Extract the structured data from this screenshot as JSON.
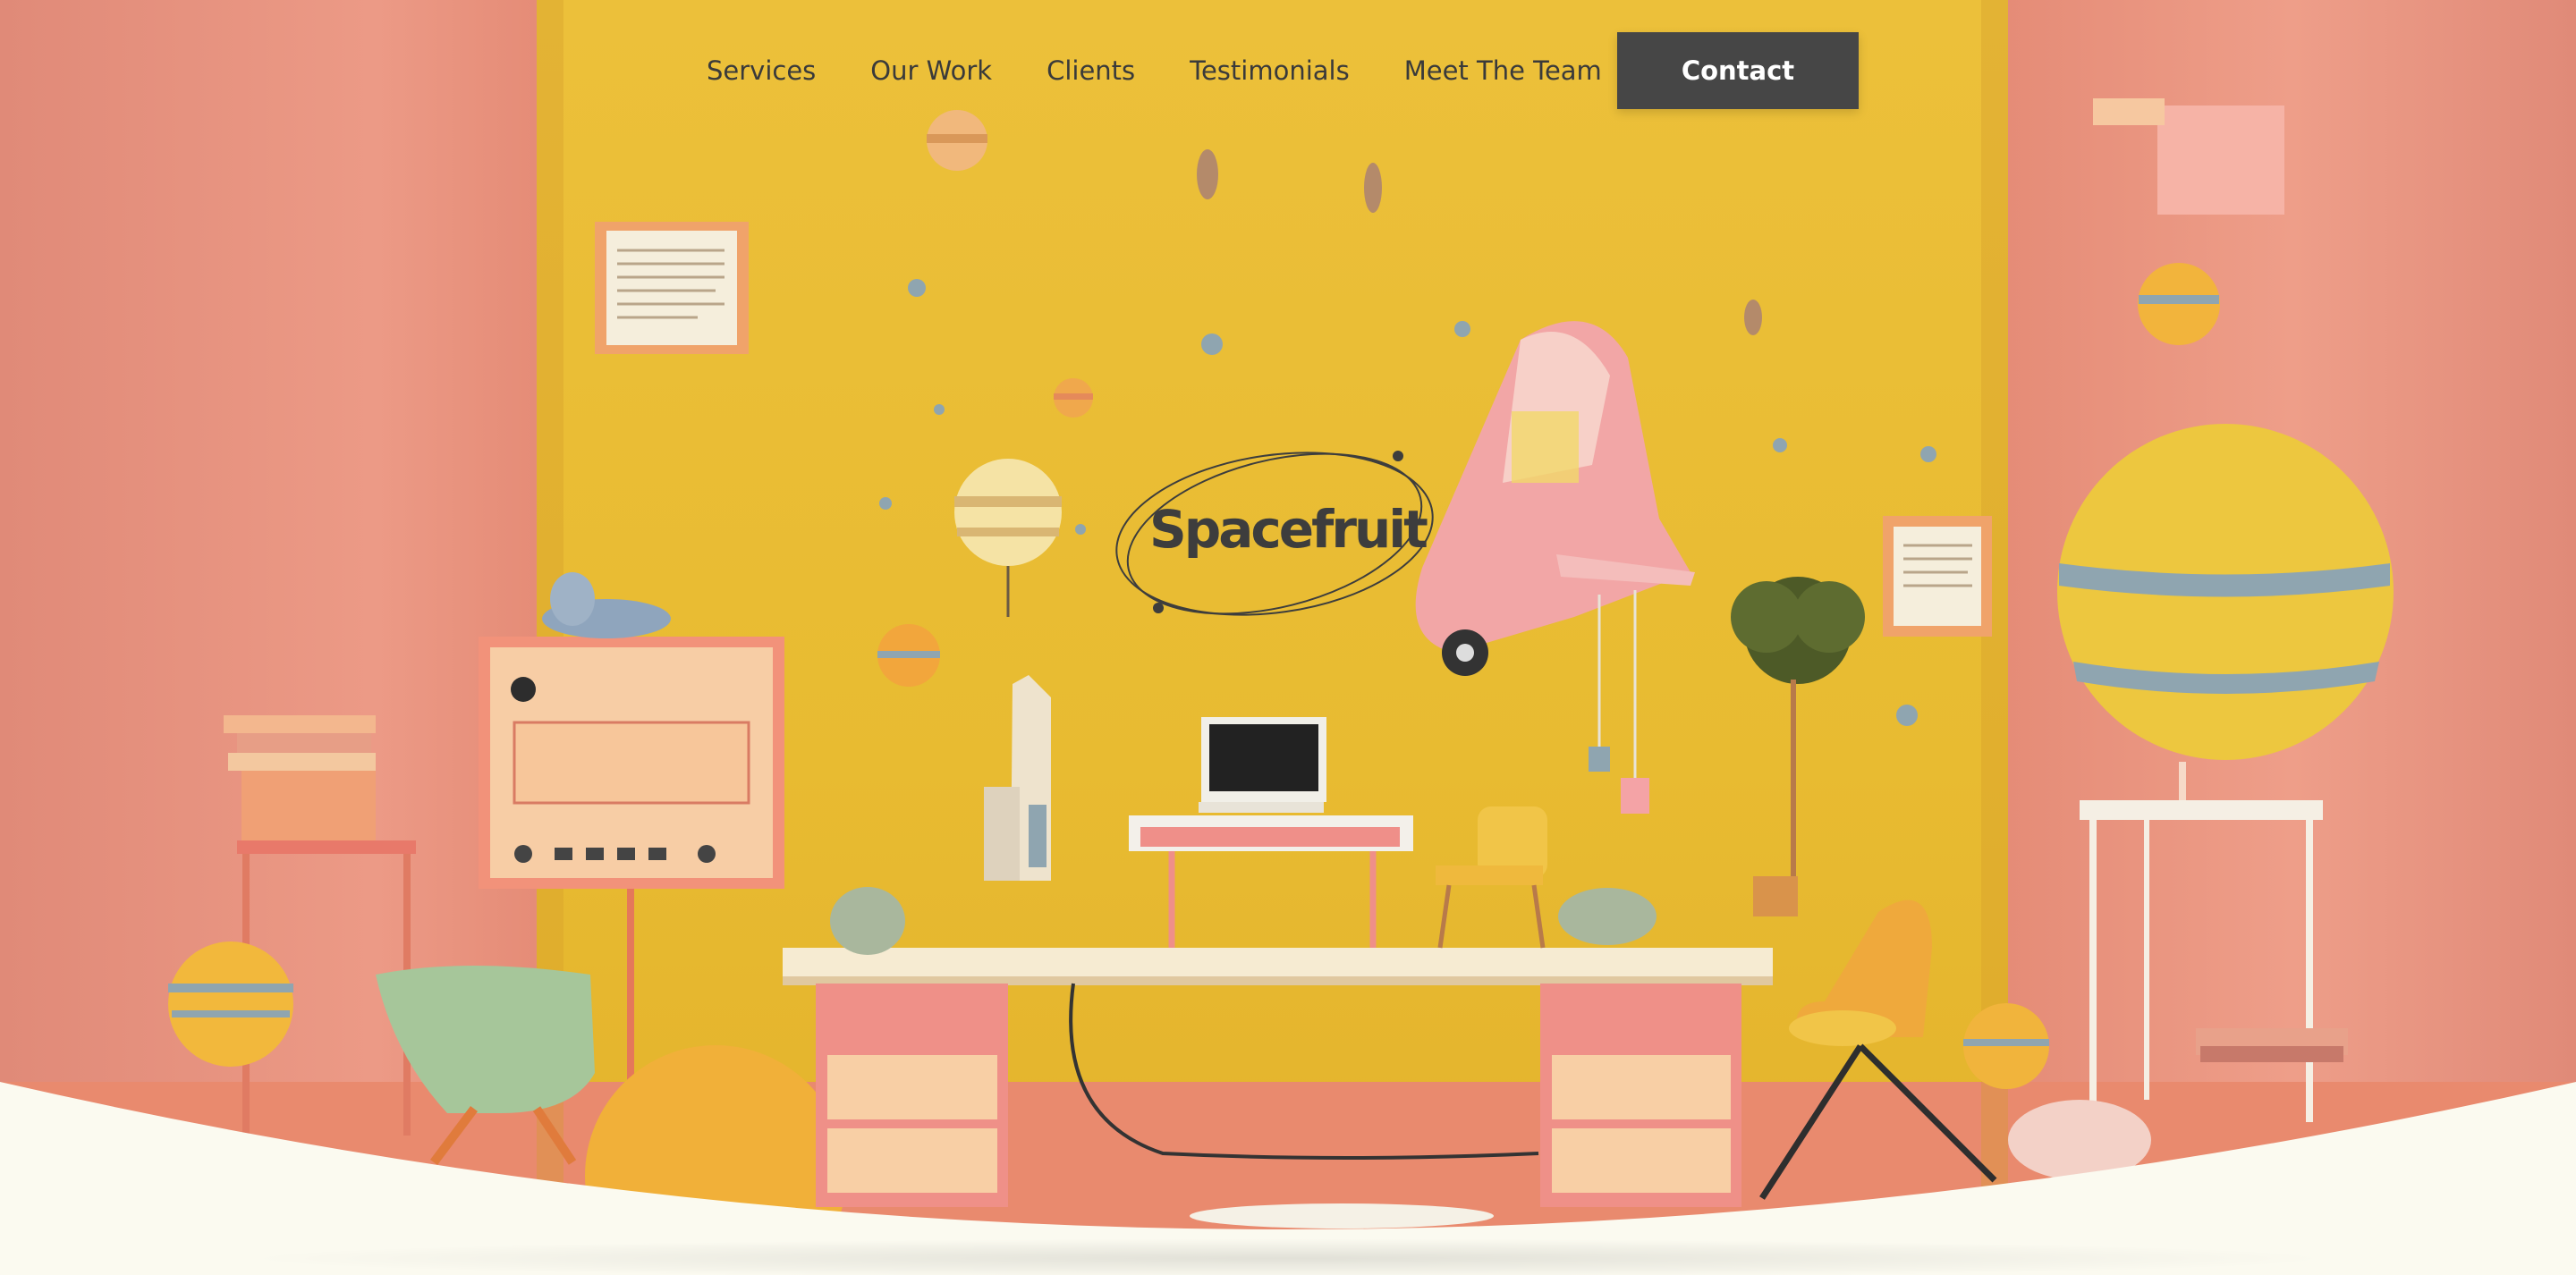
{
  "nav": {
    "links": [
      "Services",
      "Our Work",
      "Clients",
      "Testimonials",
      "Meet The Team"
    ],
    "contact_label": "Contact"
  },
  "logo": {
    "text": "Spacefruit"
  },
  "colors": {
    "wall_yellow": "#ecc03a",
    "wall_pink": "#e58c77",
    "page_bg": "#fbfaf0",
    "nav_text": "#3a3a3a",
    "button_bg": "#464646",
    "button_text": "#ffffff"
  }
}
